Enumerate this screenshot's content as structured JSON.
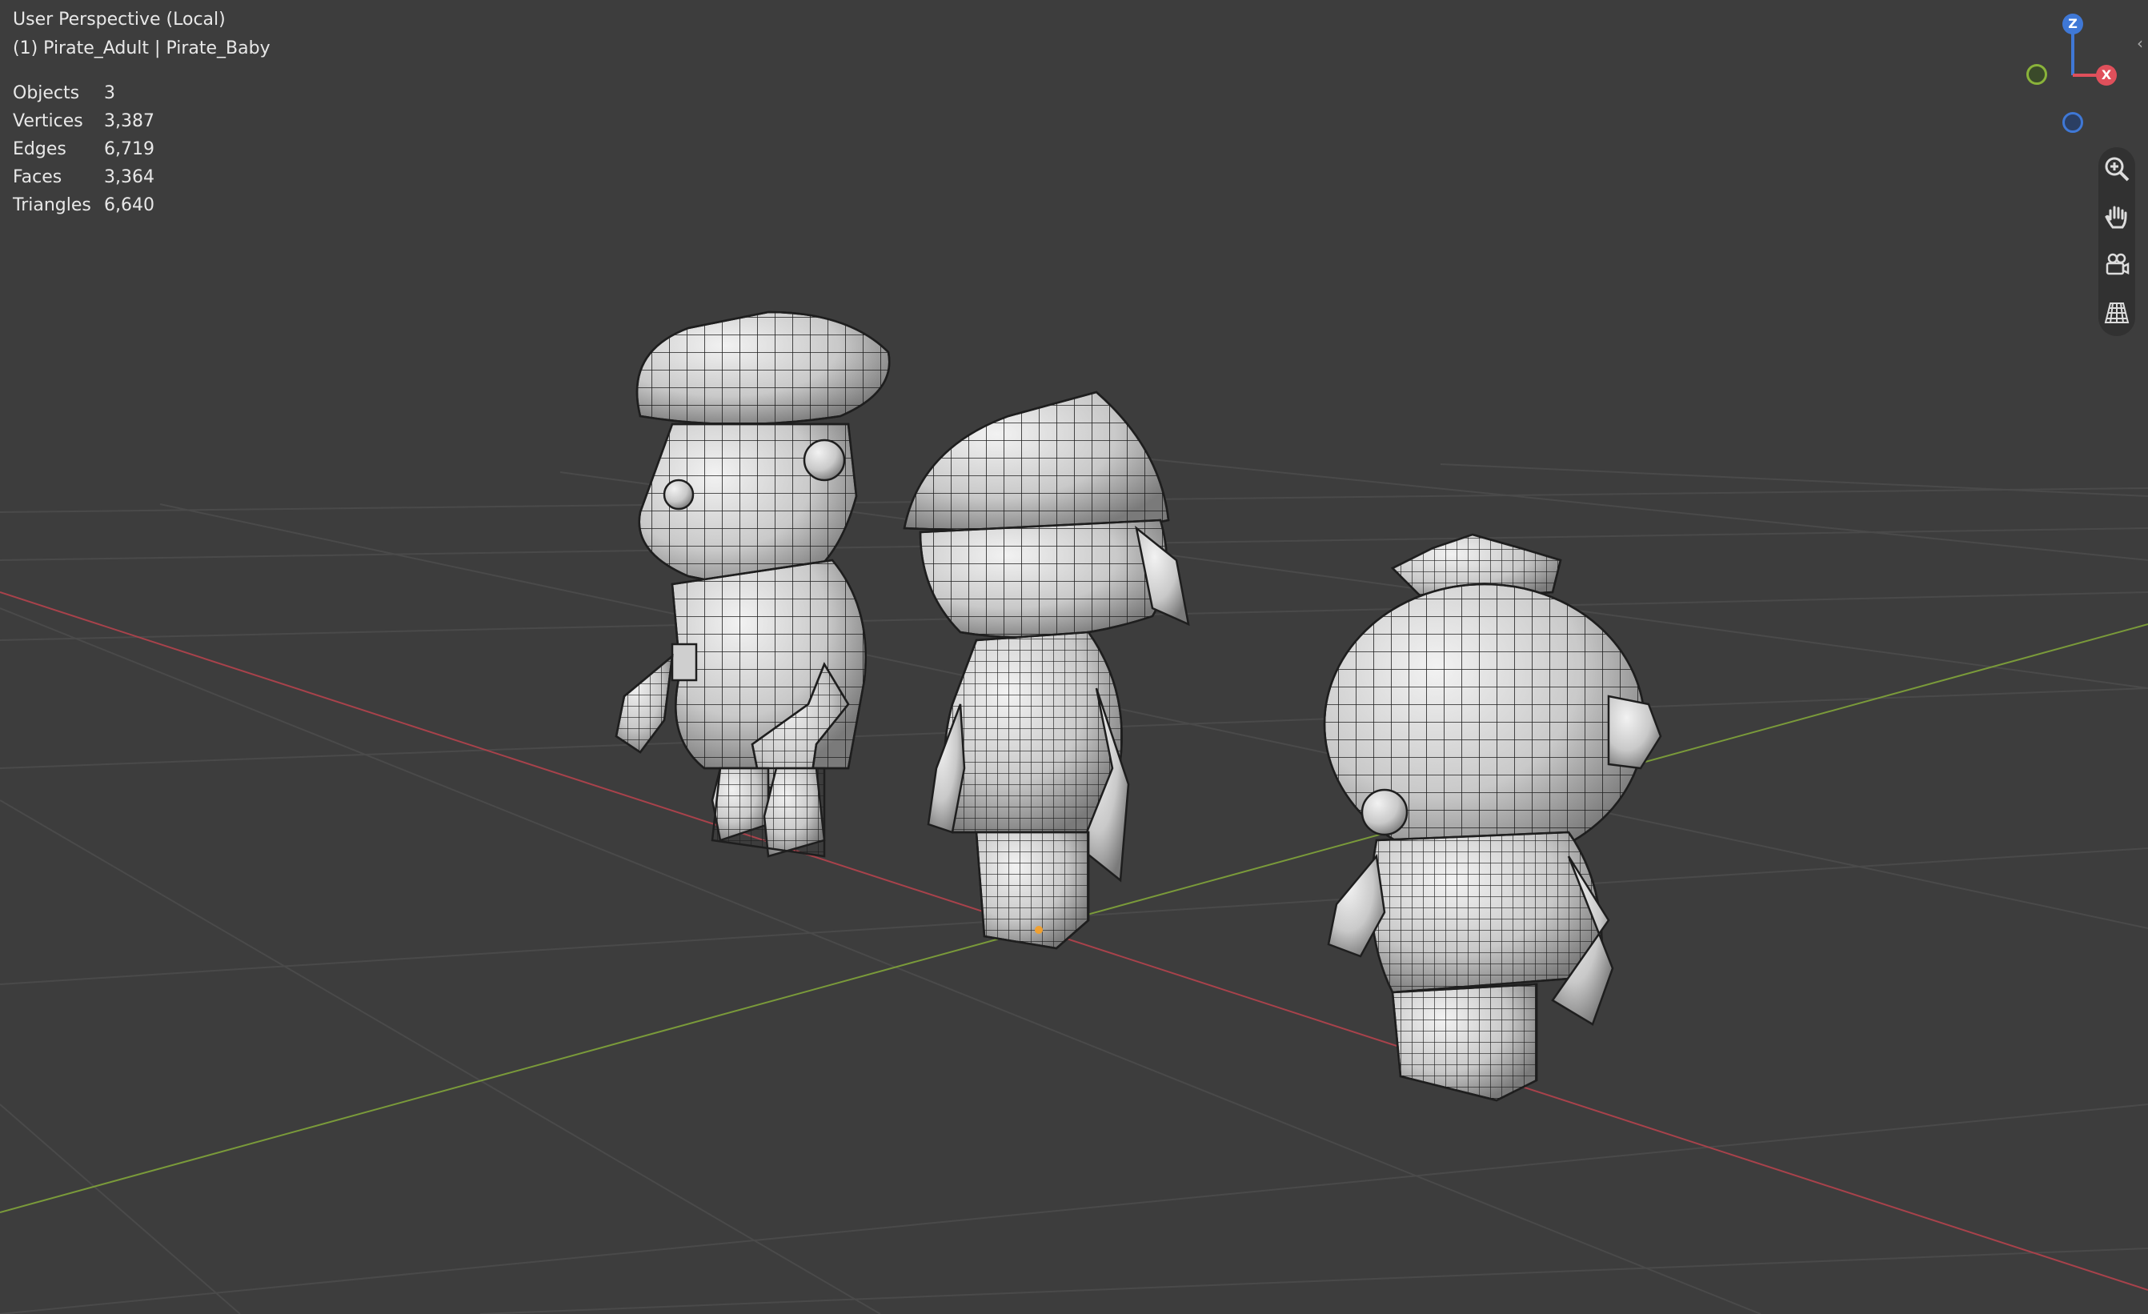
{
  "viewport": {
    "view_name": "User Perspective (Local)",
    "active_collection": "(1) Pirate_Adult | Pirate_Baby",
    "colors": {
      "background": "#3d3d3d",
      "grid": "#4b4b4b",
      "x_axis": "#a8424b",
      "y_axis": "#7a9a3a"
    }
  },
  "statistics": [
    {
      "label": "Objects",
      "value": "3"
    },
    {
      "label": "Vertices",
      "value": "3,387"
    },
    {
      "label": "Edges",
      "value": "6,719"
    },
    {
      "label": "Faces",
      "value": "3,364"
    },
    {
      "label": "Triangles",
      "value": "6,640"
    }
  ],
  "gizmo": {
    "z_label": "Z",
    "x_label": "X",
    "colors": {
      "z": "#3f78d6",
      "x": "#e0505b",
      "y": "#8ab33a"
    }
  },
  "nav_tools": [
    {
      "name": "zoom-icon"
    },
    {
      "name": "pan-hand-icon"
    },
    {
      "name": "camera-view-icon"
    },
    {
      "name": "perspective-grid-icon"
    }
  ],
  "scene_objects": [
    "pirate-adult-model",
    "pirate-child-model",
    "pirate-baby-model"
  ]
}
